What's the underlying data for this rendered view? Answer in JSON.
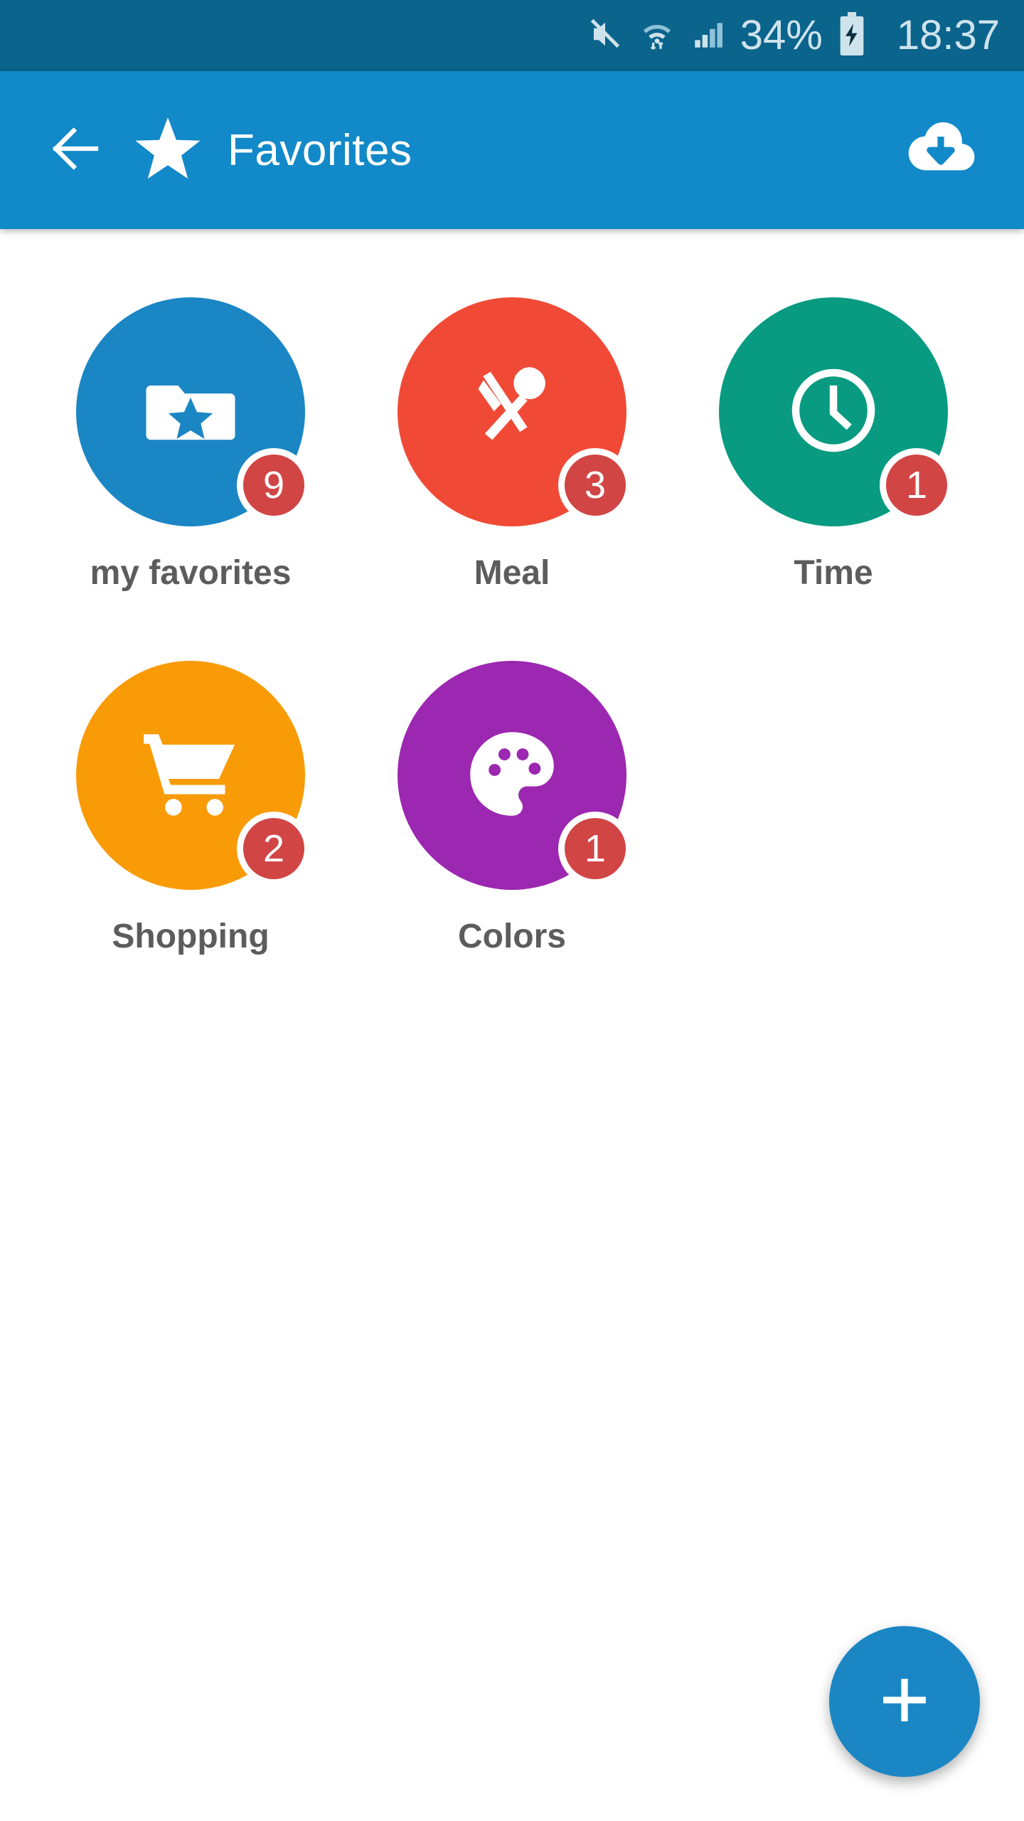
{
  "statusbar": {
    "mute_icon": "mute-icon",
    "wifi_icon": "wifi-transfer-icon",
    "signal_icon": "cellular-signal-icon",
    "battery_percent": "34%",
    "battery_icon": "battery-charging-icon",
    "time": "18:37",
    "background_color": "#0A648C",
    "foreground_color": "#CFE3EC"
  },
  "appbar": {
    "back_icon": "back-arrow-icon",
    "star_icon": "star-icon",
    "title": "Favorites",
    "download_icon": "cloud-download-icon",
    "background_color": "#1289C8",
    "foreground_color": "#FFFFFF"
  },
  "categories": [
    {
      "label": "my favorites",
      "badge": "9",
      "color": "#1B86C4",
      "icon": "folder-star-icon"
    },
    {
      "label": "Meal",
      "badge": "3",
      "color": "#F04A36",
      "icon": "fork-spoon-icon"
    },
    {
      "label": "Time",
      "badge": "1",
      "color": "#089B81",
      "icon": "clock-icon"
    },
    {
      "label": "Shopping",
      "badge": "2",
      "color": "#F99B07",
      "icon": "shopping-cart-icon"
    },
    {
      "label": "Colors",
      "badge": "1",
      "color": "#9C27B0",
      "icon": "palette-icon"
    }
  ],
  "badge_color": "#D14545",
  "label_color": "#5C5C5C",
  "fab": {
    "icon": "plus-icon",
    "color": "#1B86C4"
  }
}
